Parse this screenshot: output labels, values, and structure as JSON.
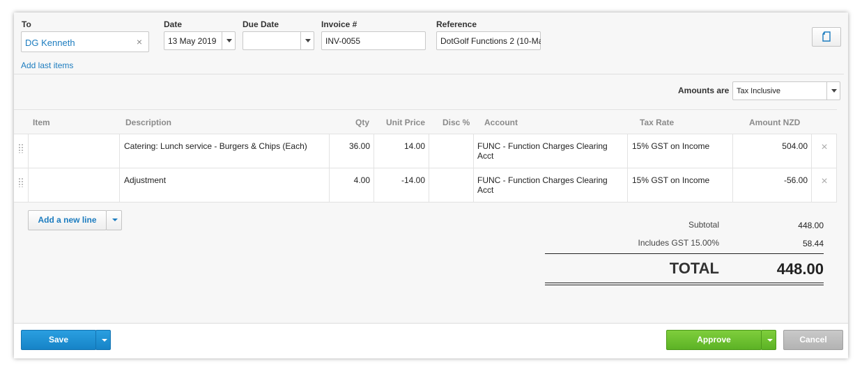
{
  "header": {
    "to_label": "To",
    "to_value": "DG Kenneth",
    "to_clear": "×",
    "date_label": "Date",
    "date_value": "13 May 2019",
    "due_label": "Due Date",
    "due_value": "",
    "invoice_label": "Invoice #",
    "invoice_value": "INV-0055",
    "reference_label": "Reference",
    "reference_value": "DotGolf Functions 2 (10-Ma",
    "add_last_items": "Add last items"
  },
  "amounts": {
    "label": "Amounts are",
    "value": "Tax Inclusive"
  },
  "table": {
    "columns": [
      "Item",
      "Description",
      "Qty",
      "Unit Price",
      "Disc %",
      "Account",
      "Tax Rate",
      "Amount NZD"
    ],
    "rows": [
      {
        "item": "",
        "description": "Catering: Lunch service - Burgers & Chips (Each)",
        "qty": "36.00",
        "unit_price": "14.00",
        "disc": "",
        "account_line1": "FUNC - Function Charges Clearing",
        "account_line2": "Acct",
        "tax_rate": "15% GST on Income",
        "amount": "504.00"
      },
      {
        "item": "",
        "description": "Adjustment",
        "qty": "4.00",
        "unit_price": "-14.00",
        "disc": "",
        "account_line1": "FUNC - Function Charges Clearing",
        "account_line2": "Acct",
        "tax_rate": "15% GST on Income",
        "amount": "-56.00"
      }
    ],
    "delete_glyph": "×",
    "add_line": "Add a new line"
  },
  "totals": {
    "subtotal_label": "Subtotal",
    "subtotal_value": "448.00",
    "gst_label": "Includes GST 15.00%",
    "gst_value": "58.44",
    "total_label": "TOTAL",
    "total_value": "448.00"
  },
  "footer": {
    "save": "Save",
    "approve": "Approve",
    "cancel": "Cancel"
  },
  "colors": {
    "link": "#1c7cbf",
    "save": "#1683c7",
    "approve": "#5cb225",
    "cancel": "#b3b3b3"
  }
}
